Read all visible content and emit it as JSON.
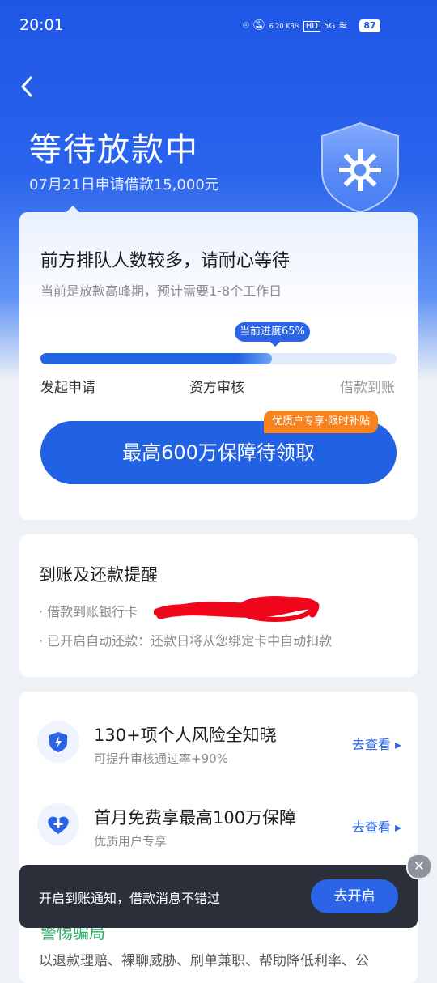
{
  "status_bar": {
    "time": "20:01",
    "battery": "87",
    "speed": "6.20 KB/s",
    "signal_label": "5G",
    "hd_label": "HD"
  },
  "header": {
    "title": "等待放款中",
    "subtitle": "07月21日申请借款15,000元"
  },
  "progress_card": {
    "headline": "前方排队人数较多，请耐心等待",
    "subline": "当前是放款高峰期，预计需要1-8个工作日",
    "progress_label": "当前进度65%",
    "progress_value": 0.65,
    "steps": [
      "发起申请",
      "资方审核",
      "借款到账"
    ],
    "promo_tag": "优质户专享·限时补贴",
    "promo_button": "最高600万保障待领取"
  },
  "reminder_card": {
    "title": "到账及还款提醒",
    "item1": "· 借款到账银行卡",
    "item2": "· 已开启自动还款：还款日将从您绑定卡中自动扣款"
  },
  "features": [
    {
      "icon": "shield-bolt-icon",
      "title": "130+项个人风险全知晓",
      "sub": "可提升审核通过率+90%",
      "link": "去查看 ▸"
    },
    {
      "icon": "heart-plus-icon",
      "title": "首月免费享最高100万保障",
      "sub": "优质用户专享",
      "link": "去查看 ▸"
    }
  ],
  "bottom_peek": {
    "title": "警惕骗局",
    "text": "以退款理赔、裸聊威胁、刷单兼职、帮助降低利率、公"
  },
  "toast": {
    "text": "开启到账通知，借款消息不错过",
    "button": "去开启",
    "close": "✕"
  },
  "colors": {
    "primary": "#2162e4",
    "accent_orange": "#f7821e",
    "toast_bg": "#2a2f3a"
  }
}
